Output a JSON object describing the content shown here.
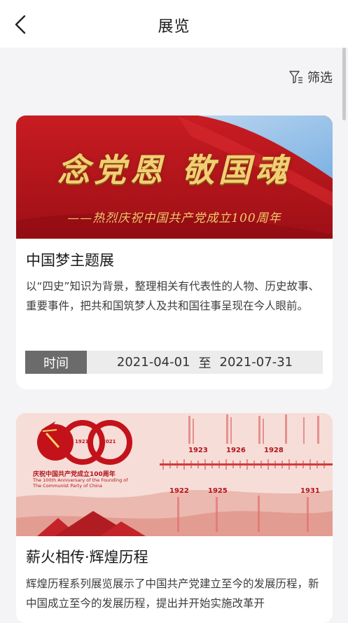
{
  "header": {
    "title": "展览",
    "back_icon": "chevron-left-icon"
  },
  "filter": {
    "label": "筛选",
    "icon": "filter-icon"
  },
  "exhibitions": [
    {
      "banner": {
        "title": "念党恩 敬国魂",
        "subtitle": "——热烈庆祝中国共产党成立100周年",
        "colors": {
          "primary": "#b4141c",
          "gold": "#f2cf74",
          "sky": "#7fb6e6"
        }
      },
      "title": "中国梦主题展",
      "description": "以“四史”知识为背景，整理相关有代表性的人物、历史故事、重要事件，把共和国筑梦人及共和国往事呈现在今人眼前。",
      "time_label": "时间",
      "start_date": "2021-04-01",
      "date_separator": "至",
      "end_date": "2021-07-31"
    },
    {
      "banner": {
        "logo_number": "100",
        "logo_years": [
          "1921",
          "2021"
        ],
        "logo_caption": "庆祝中国共产党成立100周年",
        "logo_caption_en": "The 100th Anniversary of the Founding of The Communist Party of China",
        "timeline_years_top": [
          "1923",
          "1926",
          "1928"
        ],
        "timeline_years_bottom": [
          "1922",
          "1925",
          "1931"
        ]
      },
      "title": "薪火相传·辉煌历程",
      "description": "辉煌历程系列展览展示了中国共产党建立至今的发展历程，新中国成立至今的发展历程，提出并开始实施改革开"
    }
  ]
}
